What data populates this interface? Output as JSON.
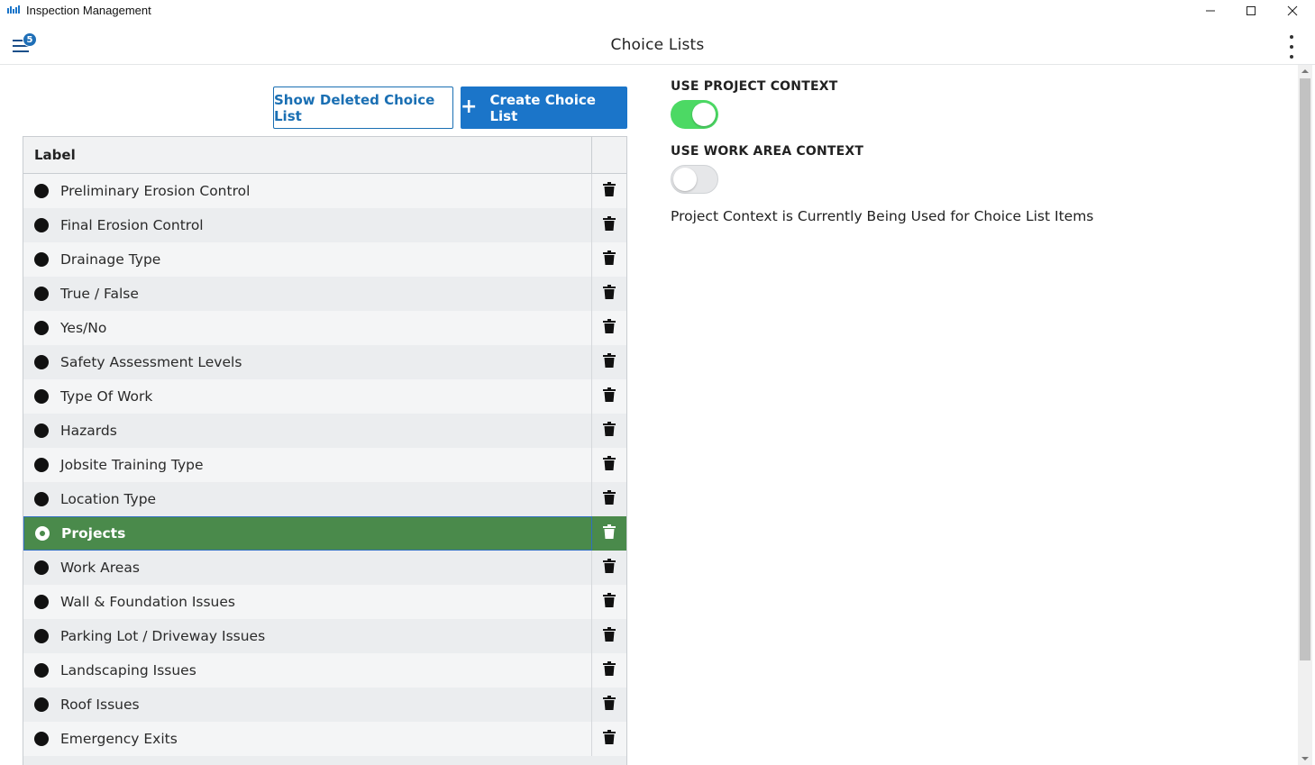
{
  "window": {
    "title": "Inspection Management",
    "icon": "app-logo-icon"
  },
  "header": {
    "title": "Choice Lists",
    "menu_badge": "5"
  },
  "actions": {
    "show_deleted_label": "Show Deleted Choice List",
    "create_label": "Create Choice List"
  },
  "table": {
    "column_label": "Label",
    "rows": [
      "Preliminary Erosion Control",
      "Final Erosion Control",
      "Drainage Type",
      "True / False",
      "Yes/No",
      "Safety Assessment Levels",
      "Type Of Work",
      "Hazards",
      "Jobsite Training Type",
      "Location Type",
      "Projects",
      "Work Areas",
      "Wall & Foundation Issues",
      "Parking Lot / Driveway Issues",
      "Landscaping Issues",
      "Roof Issues",
      "Emergency Exits"
    ],
    "selected_index": 10
  },
  "settings": {
    "project_context_label": "USE PROJECT CONTEXT",
    "project_context_on": true,
    "work_area_context_label": "USE WORK AREA CONTEXT",
    "work_area_context_on": false,
    "status_text": "Project Context is Currently Being Used for Choice List Items"
  },
  "colors": {
    "primary": "#1b75c9",
    "selected_row": "#4a8a4b",
    "toggle_on": "#4cd964",
    "badge": "#1f6fb7"
  }
}
